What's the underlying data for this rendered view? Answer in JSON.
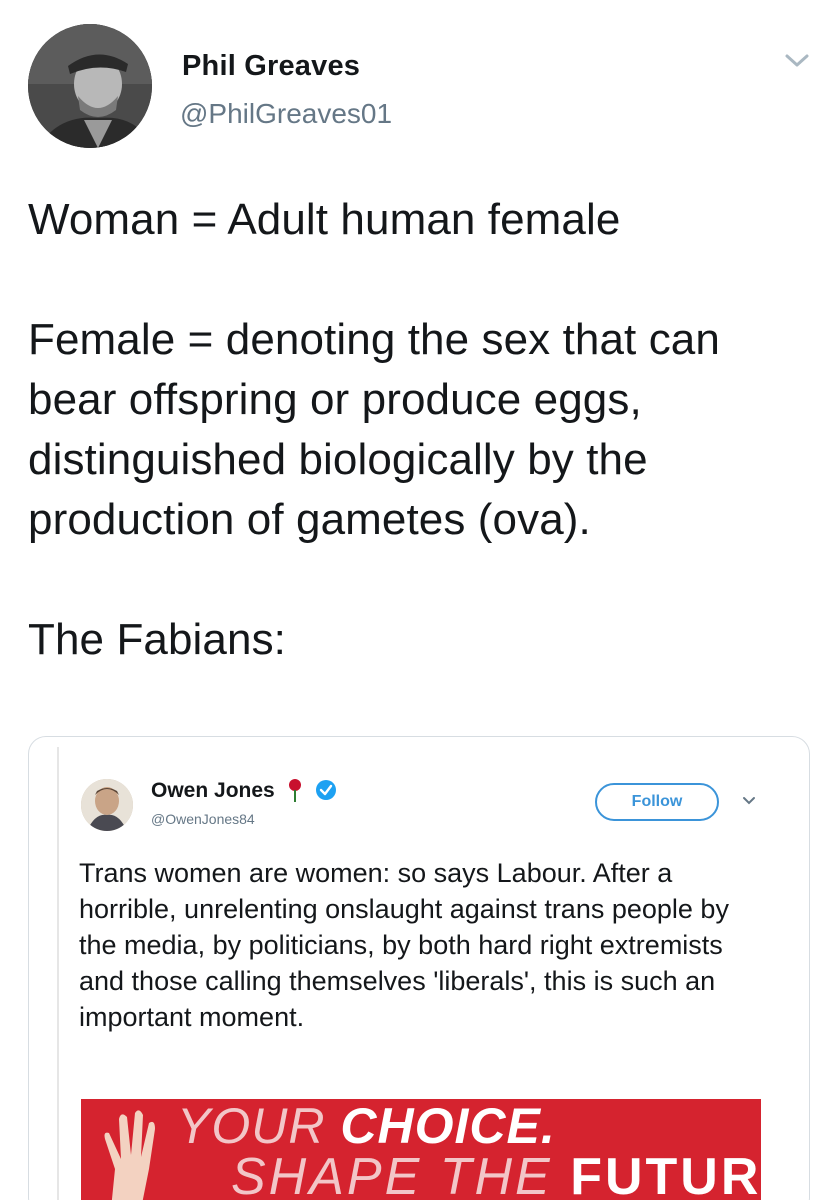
{
  "tweet": {
    "author_name": "Phil Greaves",
    "author_handle": "@PhilGreaves01",
    "menu_icon": "chevron-down-icon",
    "lines": [
      "Woman = Adult human female",
      "Female = denoting the sex that can bear offspring or produce eggs, distinguished biologically by the production of gametes (ova).",
      "The Fabians:"
    ]
  },
  "quoted": {
    "author_name": "Owen Jones",
    "author_handle": "@OwenJones84",
    "follow_label": "Follow",
    "text": "Trans women are women: so says Labour. After a horrible, unrelenting onslaught against trans people by the media, by politicians, by both hard right extremists and those calling themselves 'liberals', this is such an important moment.",
    "media": {
      "line1_light": "YOUR ",
      "line1_bold": "CHOICE.",
      "line2_light": "SHAPE THE ",
      "line2_bold": "FUTURE",
      "background": "#d5232f"
    }
  },
  "colors": {
    "text": "#14171a",
    "secondary": "#657786",
    "accent": "#3b94d9"
  }
}
